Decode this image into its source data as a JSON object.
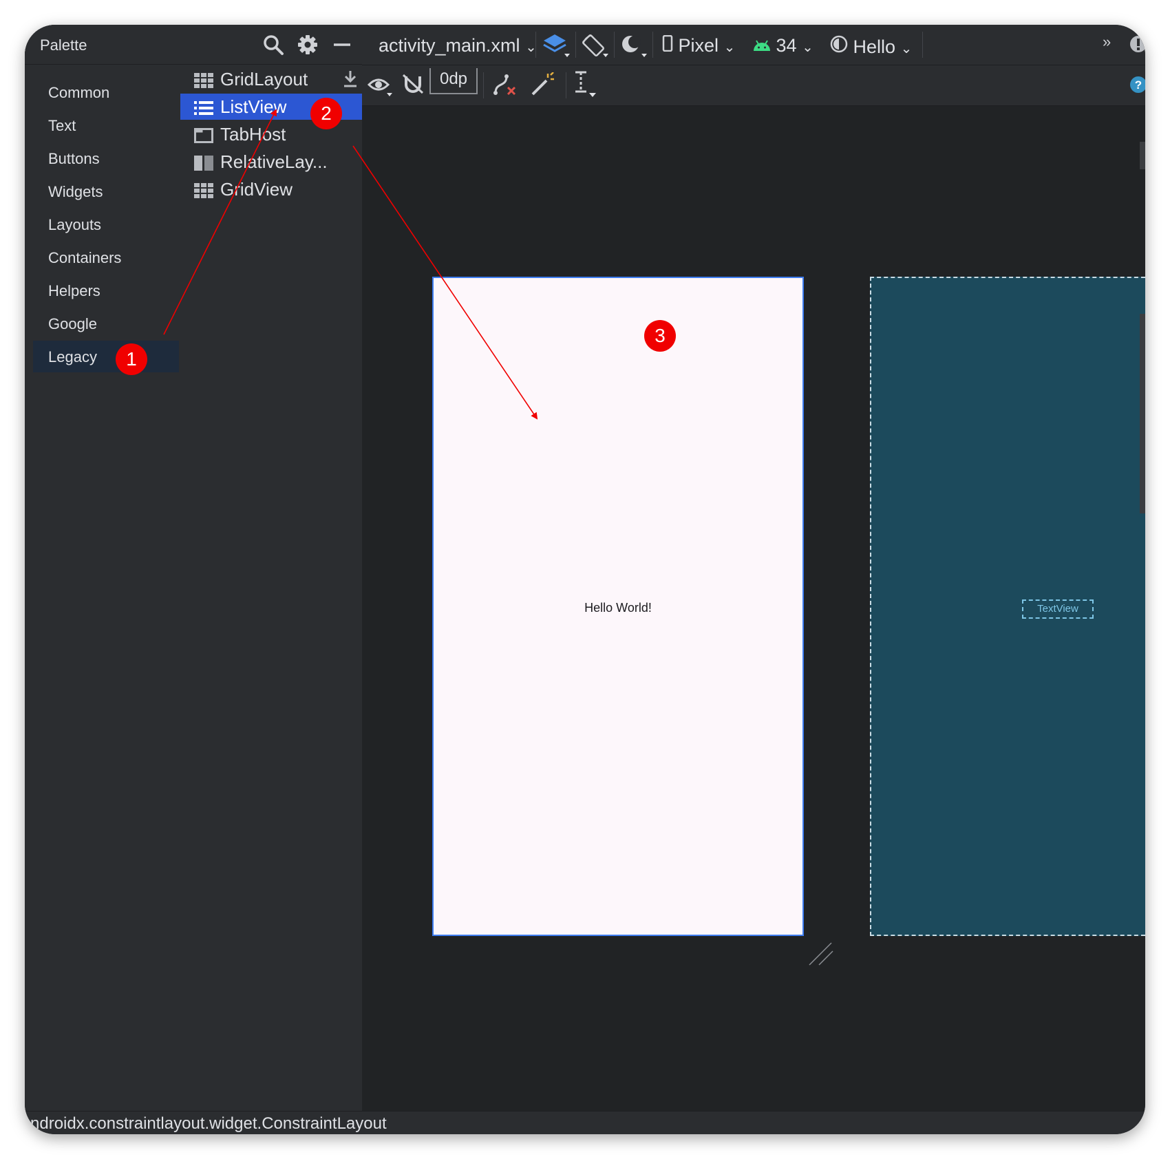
{
  "palette": {
    "title": "Palette",
    "categories": [
      {
        "label": "Common"
      },
      {
        "label": "Text"
      },
      {
        "label": "Buttons"
      },
      {
        "label": "Widgets"
      },
      {
        "label": "Layouts"
      },
      {
        "label": "Containers"
      },
      {
        "label": "Helpers"
      },
      {
        "label": "Google"
      },
      {
        "label": "Legacy"
      }
    ],
    "selected_category": "Legacy",
    "items": [
      {
        "label": "GridLayout",
        "icon": "grid-icon"
      },
      {
        "label": "ListView",
        "icon": "list-icon"
      },
      {
        "label": "TabHost",
        "icon": "tab-icon"
      },
      {
        "label": "RelativeLay...",
        "icon": "relative-layout-icon"
      },
      {
        "label": "GridView",
        "icon": "grid-icon"
      }
    ],
    "selected_item": "ListView"
  },
  "toolbar": {
    "file": "activity_main.xml",
    "device": "Pixel",
    "api_level": "34",
    "theme": "Hello",
    "margin": "0dp"
  },
  "design": {
    "hello_text": "Hello World!",
    "blueprint_label": "TextView"
  },
  "status": {
    "text": "ndroidx.constraintlayout.widget.ConstraintLayout"
  },
  "annotations": {
    "badges": [
      "1",
      "2",
      "3"
    ],
    "color": "#f00000"
  },
  "colors": {
    "selection": "#2c57d3",
    "panel": "#2b2d30",
    "canvas": "#212325",
    "blueprint": "#1c4a5c",
    "accent_green": "#3ddc84",
    "help_blue": "#3592c4"
  }
}
